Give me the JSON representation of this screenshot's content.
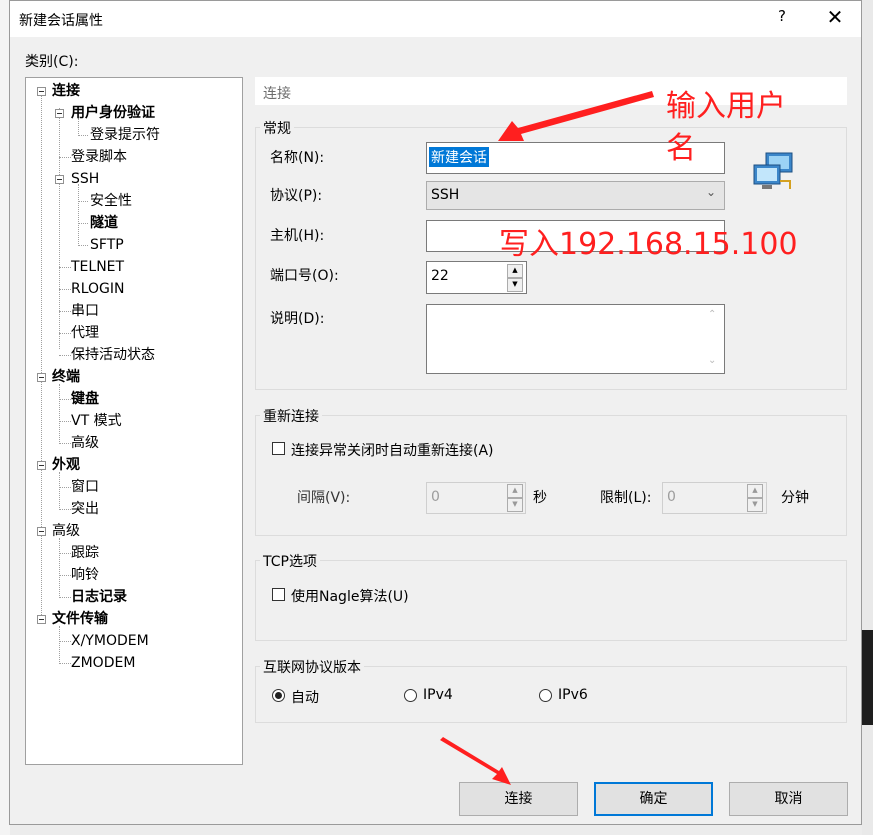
{
  "window": {
    "title": "新建会话属性",
    "help": "?",
    "close": "✕"
  },
  "category_label": "类别(C):",
  "tree": {
    "connection": "连接",
    "user_auth": "用户身份验证",
    "login_prompt": "登录提示符",
    "login_script": "登录脚本",
    "ssh": "SSH",
    "security": "安全性",
    "tunnel": "隧道",
    "sftp": "SFTP",
    "telnet": "TELNET",
    "rlogin": "RLOGIN",
    "serial": "串口",
    "proxy": "代理",
    "keepalive": "保持活动状态",
    "terminal": "终端",
    "keyboard": "键盘",
    "vt_mode": "VT 模式",
    "advanced": "高级",
    "appearance": "外观",
    "window": "窗口",
    "highlight": "突出",
    "advanced2": "高级",
    "trace": "跟踪",
    "bell": "响铃",
    "log": "日志记录",
    "file_transfer": "文件传输",
    "xymodem": "X/YMODEM",
    "zmodem": "ZMODEM"
  },
  "panel_header": "连接",
  "general": {
    "title": "常规",
    "name_label": "名称(N):",
    "name_value": "新建会话",
    "protocol_label": "协议(P):",
    "protocol_value": "SSH",
    "host_label": "主机(H):",
    "host_value": "",
    "port_label": "端口号(O):",
    "port_value": "22",
    "desc_label": "说明(D):",
    "desc_value": ""
  },
  "reconnect": {
    "title": "重新连接",
    "auto_label": "连接异常关闭时自动重新连接(A)",
    "interval_label": "间隔(V):",
    "interval_value": "0",
    "seconds": "秒",
    "limit_label": "限制(L):",
    "limit_value": "0",
    "minutes": "分钟"
  },
  "tcp": {
    "title": "TCP选项",
    "nagle_label": "使用Nagle算法(U)"
  },
  "ip_version": {
    "title": "互联网协议版本",
    "auto": "自动",
    "ipv4": "IPv4",
    "ipv6": "IPv6",
    "selected": "auto"
  },
  "buttons": {
    "connect": "连接",
    "ok": "确定",
    "cancel": "取消"
  },
  "annotations": {
    "username_line1": "输入用户",
    "username_line2": "名",
    "host_note": "写入192.168.15.100"
  },
  "colors": {
    "annotation": "#ff1f1f",
    "selection": "#0078d7",
    "default_button_border": "#0078d7"
  },
  "icons": {
    "session": "network-computers-icon"
  }
}
